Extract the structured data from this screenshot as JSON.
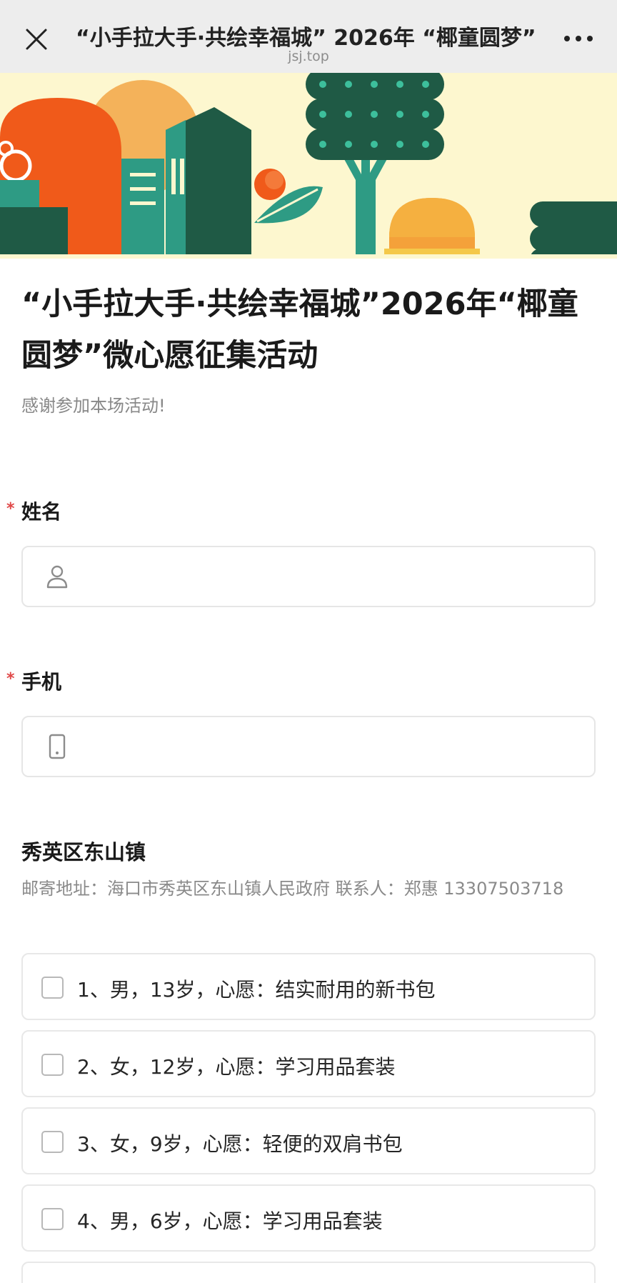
{
  "browser": {
    "title": "“小手拉大手·共绘幸福城” 2026年 “椰童圆梦”微心愿征集活动",
    "url": "jsj.top",
    "close_icon": "close-icon",
    "more_icon": "more-dots-icon"
  },
  "banner": {
    "description_icon": "city-illustration-banner",
    "colors": {
      "background": "#fdf7cf",
      "orange": "#f05a1a",
      "dark_green": "#1f5a45",
      "teal": "#2e9b84",
      "sun": "#f4a13a"
    }
  },
  "form": {
    "title": "“小手拉大手·共绘幸福城”2026年“椰童圆梦”微心愿征集活动",
    "subtitle": "感谢参加本场活动!",
    "fields": [
      {
        "label": "姓名",
        "required": "*",
        "icon": "person-icon",
        "value": ""
      },
      {
        "label": "手机",
        "required": "*",
        "icon": "mobile-phone-icon",
        "value": ""
      }
    ],
    "section": {
      "title": "秀英区东山镇",
      "description": "邮寄地址：海口市秀英区东山镇人民政府 联系人：郑惠 13307503718",
      "options": [
        {
          "label": "1、男，13岁，心愿：结实耐用的新书包",
          "checked": false
        },
        {
          "label": "2、女，12岁，心愿：学习用品套装",
          "checked": false
        },
        {
          "label": "3、女，9岁，心愿：轻便的双肩书包",
          "checked": false
        },
        {
          "label": "4、男，6岁，心愿：学习用品套装",
          "checked": false
        }
      ]
    },
    "colors": {
      "required": "#e04848",
      "border": "#e6e6e6",
      "muted_text": "#8a8a8a"
    }
  }
}
